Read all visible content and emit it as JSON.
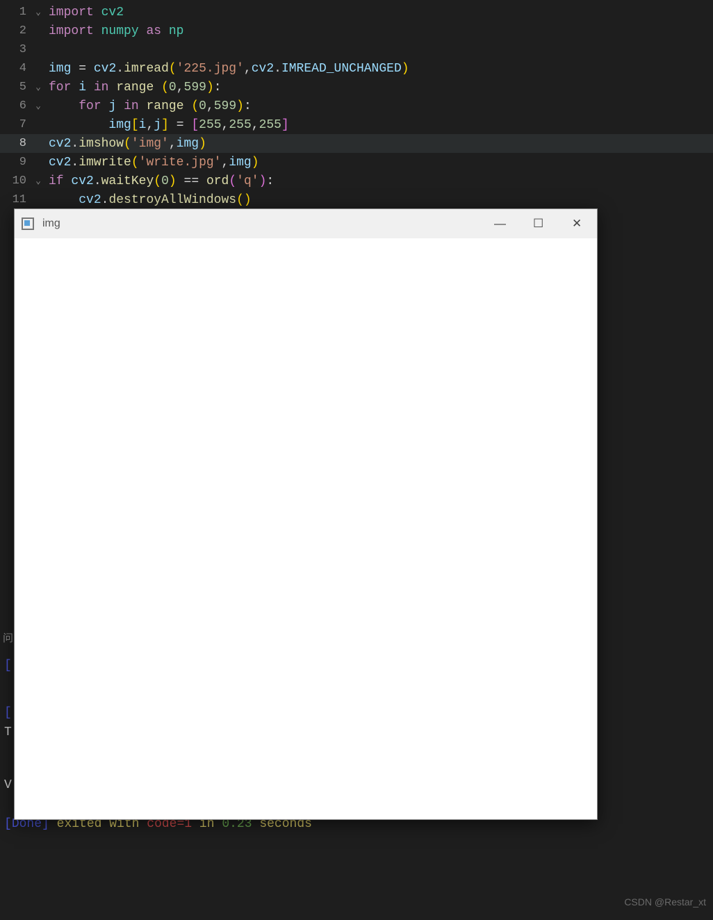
{
  "code": {
    "lines": [
      {
        "n": "1",
        "fold": "⌄",
        "seg": [
          [
            "kw",
            "import"
          ],
          [
            "op",
            " "
          ],
          [
            "cls",
            "cv2"
          ]
        ]
      },
      {
        "n": "2",
        "fold": "",
        "seg": [
          [
            "kw",
            "import"
          ],
          [
            "op",
            " "
          ],
          [
            "cls",
            "numpy"
          ],
          [
            "op",
            " "
          ],
          [
            "kw",
            "as"
          ],
          [
            "op",
            " "
          ],
          [
            "cls",
            "np"
          ]
        ]
      },
      {
        "n": "3",
        "fold": "",
        "seg": []
      },
      {
        "n": "4",
        "fold": "",
        "seg": [
          [
            "var",
            "img"
          ],
          [
            "op",
            " "
          ],
          [
            "op",
            "="
          ],
          [
            "op",
            " "
          ],
          [
            "var",
            "cv2"
          ],
          [
            "op",
            "."
          ],
          [
            "fn",
            "imread"
          ],
          [
            "pun",
            "("
          ],
          [
            "str",
            "'225.jpg'"
          ],
          [
            "op",
            ","
          ],
          [
            "var",
            "cv2"
          ],
          [
            "op",
            "."
          ],
          [
            "var",
            "IMREAD_UNCHANGED"
          ],
          [
            "pun",
            ")"
          ]
        ]
      },
      {
        "n": "5",
        "fold": "⌄",
        "seg": [
          [
            "kw",
            "for"
          ],
          [
            "op",
            " "
          ],
          [
            "var",
            "i"
          ],
          [
            "op",
            " "
          ],
          [
            "kw",
            "in"
          ],
          [
            "op",
            " "
          ],
          [
            "fn",
            "range"
          ],
          [
            "op",
            " "
          ],
          [
            "pun",
            "("
          ],
          [
            "num",
            "0"
          ],
          [
            "op",
            ","
          ],
          [
            "num",
            "599"
          ],
          [
            "pun",
            ")"
          ],
          [
            "op",
            ":"
          ]
        ]
      },
      {
        "n": "6",
        "fold": "⌄",
        "seg": [
          [
            "op",
            "    "
          ],
          [
            "kw",
            "for"
          ],
          [
            "op",
            " "
          ],
          [
            "var",
            "j"
          ],
          [
            "op",
            " "
          ],
          [
            "kw",
            "in"
          ],
          [
            "op",
            " "
          ],
          [
            "fn",
            "range"
          ],
          [
            "op",
            " "
          ],
          [
            "pun",
            "("
          ],
          [
            "num",
            "0"
          ],
          [
            "op",
            ","
          ],
          [
            "num",
            "599"
          ],
          [
            "pun",
            ")"
          ],
          [
            "op",
            ":"
          ]
        ]
      },
      {
        "n": "7",
        "fold": "",
        "seg": [
          [
            "op",
            "        "
          ],
          [
            "var",
            "img"
          ],
          [
            "pun",
            "["
          ],
          [
            "var",
            "i"
          ],
          [
            "op",
            ","
          ],
          [
            "var",
            "j"
          ],
          [
            "pun",
            "]"
          ],
          [
            "op",
            " "
          ],
          [
            "op",
            "="
          ],
          [
            "op",
            " "
          ],
          [
            "punP",
            "["
          ],
          [
            "num",
            "255"
          ],
          [
            "op",
            ","
          ],
          [
            "num",
            "255"
          ],
          [
            "op",
            ","
          ],
          [
            "num",
            "255"
          ],
          [
            "punP",
            "]"
          ]
        ]
      },
      {
        "n": "8",
        "fold": "",
        "current": true,
        "seg": [
          [
            "var",
            "cv2"
          ],
          [
            "op",
            "."
          ],
          [
            "fn",
            "imshow"
          ],
          [
            "pun",
            "("
          ],
          [
            "str",
            "'img'"
          ],
          [
            "op",
            ","
          ],
          [
            "var",
            "img"
          ],
          [
            "pun",
            ")"
          ]
        ]
      },
      {
        "n": "9",
        "fold": "",
        "seg": [
          [
            "var",
            "cv2"
          ],
          [
            "op",
            "."
          ],
          [
            "fn",
            "imwrite"
          ],
          [
            "pun",
            "("
          ],
          [
            "str",
            "'write.jpg'"
          ],
          [
            "op",
            ","
          ],
          [
            "var",
            "img"
          ],
          [
            "pun",
            ")"
          ]
        ]
      },
      {
        "n": "10",
        "fold": "⌄",
        "seg": [
          [
            "kw",
            "if"
          ],
          [
            "op",
            " "
          ],
          [
            "var",
            "cv2"
          ],
          [
            "op",
            "."
          ],
          [
            "fn",
            "waitKey"
          ],
          [
            "pun",
            "("
          ],
          [
            "num",
            "0"
          ],
          [
            "pun",
            ")"
          ],
          [
            "op",
            " "
          ],
          [
            "op",
            "=="
          ],
          [
            "op",
            " "
          ],
          [
            "fn",
            "ord"
          ],
          [
            "punP",
            "("
          ],
          [
            "str",
            "'q'"
          ],
          [
            "punP",
            ")"
          ],
          [
            "op",
            ":"
          ]
        ]
      },
      {
        "n": "11",
        "fold": "",
        "seg": [
          [
            "op",
            "    "
          ],
          [
            "var",
            "cv2"
          ],
          [
            "op",
            "."
          ],
          [
            "fn",
            "destroyAllWindows"
          ],
          [
            "pun",
            "("
          ],
          [
            "pun",
            ")"
          ]
        ]
      }
    ]
  },
  "panel": {
    "tab0": "问"
  },
  "terminal": {
    "l0a": "[",
    "l0b": "",
    "l0c": "",
    "l1a": "[",
    "l2": "T",
    "l3": "V.",
    "done_open": "[",
    "done_label": "Done",
    "done_close": "]",
    "exited": " exited with ",
    "code_label": "code=1",
    "in_label": " in ",
    "time": "0.23",
    "seconds": " seconds"
  },
  "window": {
    "title": "img",
    "minimize": "—",
    "maximize": "☐",
    "close": "✕"
  },
  "watermark": "CSDN @Restar_xt"
}
